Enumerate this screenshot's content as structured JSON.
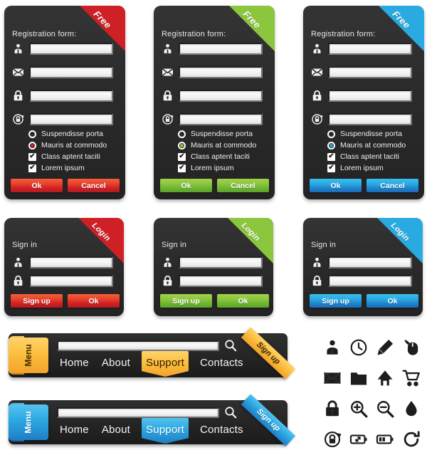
{
  "theme_colors": {
    "red": "#cf2026",
    "green": "#8cc63f",
    "blue": "#29abe2",
    "gold": "#fcbf3f",
    "panel_dark": "#2b2b2b",
    "input_white": "#f4f4f4"
  },
  "registration_cards": [
    {
      "ribbon": "Free",
      "accent": "red",
      "title": "Registration form:",
      "fields": [
        {
          "icon": "user-icon",
          "value": "",
          "placeholder": ""
        },
        {
          "icon": "envelope-icon",
          "value": "",
          "placeholder": ""
        },
        {
          "icon": "lock-icon",
          "value": "",
          "placeholder": ""
        },
        {
          "icon": "lock-refresh-icon",
          "value": "",
          "placeholder": ""
        }
      ],
      "options": [
        {
          "type": "radio",
          "label": "Suspendisse porta",
          "checked": false
        },
        {
          "type": "radio",
          "label": "Mauris at commodo",
          "checked": true
        },
        {
          "type": "checkbox",
          "label": "Class aptent taciti",
          "checked": true
        },
        {
          "type": "checkbox",
          "label": "Lorem ipsum",
          "checked": true
        }
      ],
      "buttons": [
        {
          "label": "Ok"
        },
        {
          "label": "Cancel"
        }
      ]
    },
    {
      "ribbon": "Free",
      "accent": "green",
      "title": "Registration form:",
      "fields": [
        {
          "icon": "user-icon",
          "value": "",
          "placeholder": ""
        },
        {
          "icon": "envelope-icon",
          "value": "",
          "placeholder": ""
        },
        {
          "icon": "lock-icon",
          "value": "",
          "placeholder": ""
        },
        {
          "icon": "lock-refresh-icon",
          "value": "",
          "placeholder": ""
        }
      ],
      "options": [
        {
          "type": "radio",
          "label": "Suspendisse porta",
          "checked": false
        },
        {
          "type": "radio",
          "label": "Mauris at commodo",
          "checked": true
        },
        {
          "type": "checkbox",
          "label": "Class aptent taciti",
          "checked": true
        },
        {
          "type": "checkbox",
          "label": "Lorem ipsum",
          "checked": true
        }
      ],
      "buttons": [
        {
          "label": "Ok"
        },
        {
          "label": "Cancel"
        }
      ]
    },
    {
      "ribbon": "Free",
      "accent": "blue",
      "title": "Registration form:",
      "fields": [
        {
          "icon": "user-icon",
          "value": "",
          "placeholder": ""
        },
        {
          "icon": "envelope-icon",
          "value": "",
          "placeholder": ""
        },
        {
          "icon": "lock-icon",
          "value": "",
          "placeholder": ""
        },
        {
          "icon": "lock-refresh-icon",
          "value": "",
          "placeholder": ""
        }
      ],
      "options": [
        {
          "type": "radio",
          "label": "Suspendisse porta",
          "checked": false
        },
        {
          "type": "radio",
          "label": "Mauris at commodo",
          "checked": true
        },
        {
          "type": "checkbox",
          "label": "Class aptent taciti",
          "checked": true
        },
        {
          "type": "checkbox",
          "label": "Lorem ipsum",
          "checked": true
        }
      ],
      "buttons": [
        {
          "label": "Ok"
        },
        {
          "label": "Cancel"
        }
      ]
    }
  ],
  "signin_cards": [
    {
      "ribbon": "Login",
      "accent": "red",
      "title": "Sign in",
      "fields": [
        {
          "icon": "user-icon",
          "value": "",
          "placeholder": ""
        },
        {
          "icon": "lock-icon",
          "value": "",
          "placeholder": ""
        }
      ],
      "buttons": [
        {
          "label": "Sign up"
        },
        {
          "label": "Ok"
        }
      ]
    },
    {
      "ribbon": "Login",
      "accent": "green",
      "title": "Sign in",
      "fields": [
        {
          "icon": "user-icon",
          "value": "",
          "placeholder": ""
        },
        {
          "icon": "lock-icon",
          "value": "",
          "placeholder": ""
        }
      ],
      "buttons": [
        {
          "label": "Sign up"
        },
        {
          "label": "Ok"
        }
      ]
    },
    {
      "ribbon": "Login",
      "accent": "blue",
      "title": "Sign in",
      "fields": [
        {
          "icon": "user-icon",
          "value": "",
          "placeholder": ""
        },
        {
          "icon": "lock-icon",
          "value": "",
          "placeholder": ""
        }
      ],
      "buttons": [
        {
          "label": "Sign up"
        },
        {
          "label": "Ok"
        }
      ]
    }
  ],
  "navbars": [
    {
      "accent": "gold",
      "menu_label": "Menu",
      "search": {
        "value": "",
        "placeholder": ""
      },
      "search_icon": "search-icon",
      "signup_label": "Sign up",
      "links": [
        {
          "label": "Home",
          "active": false
        },
        {
          "label": "About",
          "active": false
        },
        {
          "label": "Support",
          "active": true
        },
        {
          "label": "Contacts",
          "active": false
        }
      ]
    },
    {
      "accent": "blue",
      "menu_label": "Menu",
      "search": {
        "value": "",
        "placeholder": ""
      },
      "search_icon": "search-icon",
      "signup_label": "Sign up",
      "links": [
        {
          "label": "Home",
          "active": false
        },
        {
          "label": "About",
          "active": false
        },
        {
          "label": "Support",
          "active": true
        },
        {
          "label": "Contacts",
          "active": false
        }
      ]
    }
  ],
  "icon_grid": [
    "user-icon",
    "clock-icon",
    "pencil-icon",
    "mouse-icon",
    "envelope-icon",
    "folder-icon",
    "home-icon",
    "cart-icon",
    "lock-icon",
    "zoom-in-icon",
    "zoom-out-icon",
    "droplet-icon",
    "lock-refresh-icon",
    "battery-charging-icon",
    "battery-half-icon",
    "refresh-icon"
  ]
}
